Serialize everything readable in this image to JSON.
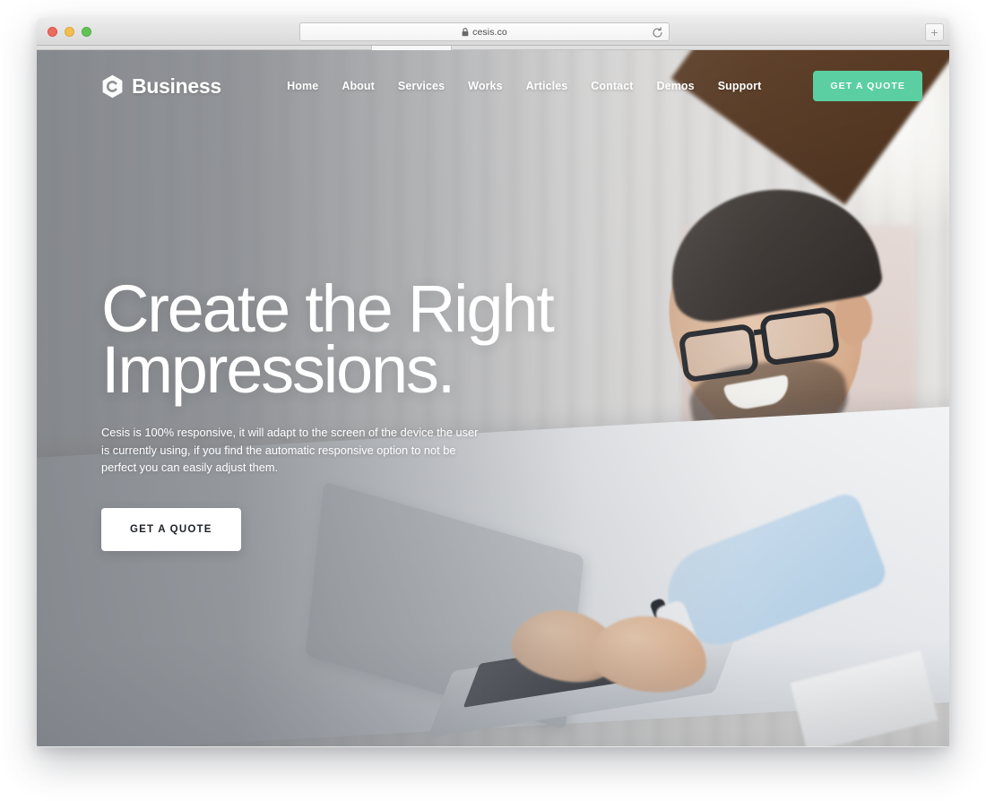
{
  "browser": {
    "url": "cesis.co",
    "lock_icon": "lock-icon",
    "reload_icon": "reload-icon",
    "newtab_label": "+",
    "traffic_lights": [
      "close",
      "minimize",
      "maximize"
    ]
  },
  "site": {
    "brand": {
      "icon": "hexagon-c-logo-icon",
      "name": "Business"
    },
    "nav": [
      {
        "label": "Home"
      },
      {
        "label": "About"
      },
      {
        "label": "Services"
      },
      {
        "label": "Works"
      },
      {
        "label": "Articles"
      },
      {
        "label": "Contact"
      },
      {
        "label": "Demos"
      },
      {
        "label": "Support"
      }
    ],
    "header_cta": "GET A QUOTE",
    "hero": {
      "title_line_1": "Create the Right",
      "title_line_2": "Impressions.",
      "subtitle": "Cesis is 100% responsive, it will adapt to the screen of the device the user is currently using, if you find the automatic responsive option to not be perfect you can easily adjust them.",
      "cta": "GET A QUOTE"
    }
  },
  "colors": {
    "accent_green": "#5bcfa2",
    "hero_text": "#ffffff",
    "cta_text": "#1d2024",
    "overlay_grey": "#747a80"
  }
}
